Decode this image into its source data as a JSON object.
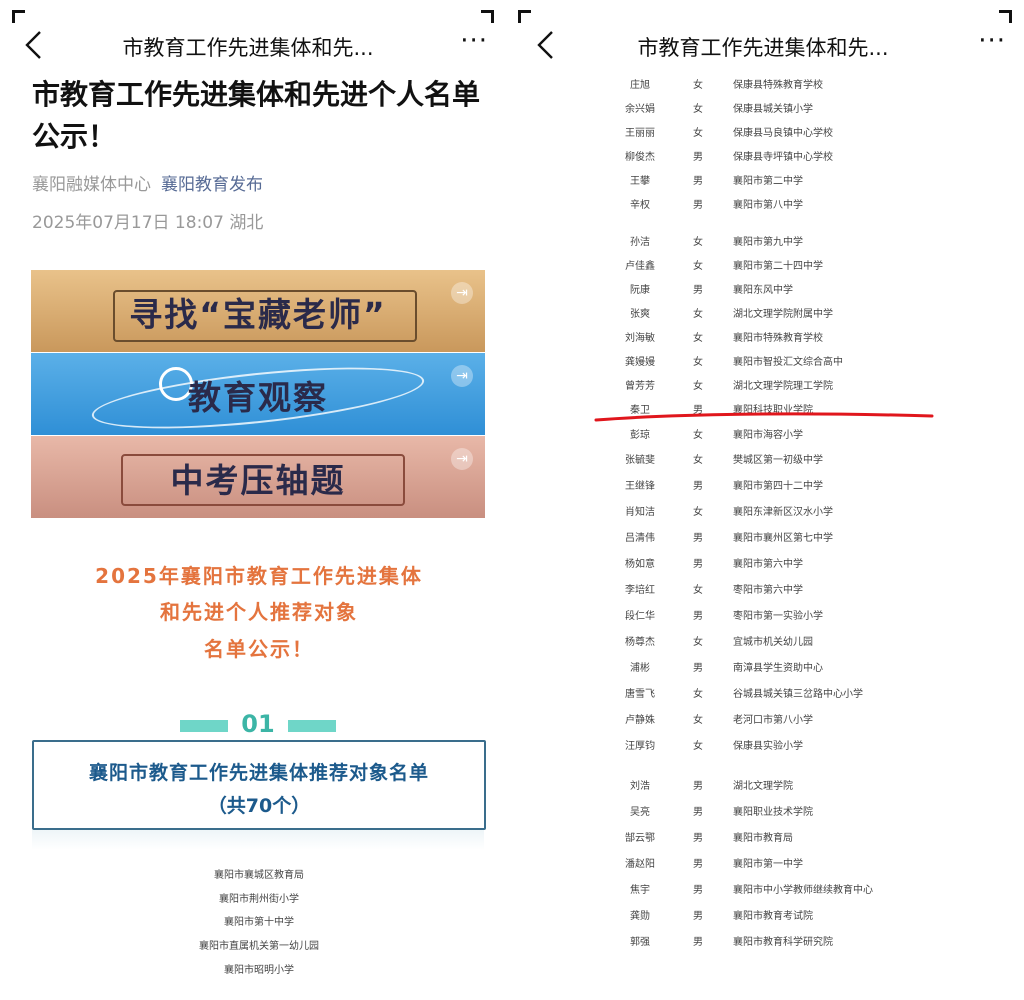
{
  "left": {
    "nav_title": "市教育工作先进集体和先...",
    "more": "···",
    "article_title": "市教育工作先进集体和先进个人名单公示！",
    "source1": "襄阳融媒体中心",
    "source2": "襄阳教育发布",
    "datetime": "2025年07月17日 18:07  湖北",
    "banners": [
      "寻找“宝藏老师”",
      "教育观察",
      "中考压轴题"
    ],
    "headline_lines": [
      "2025年襄阳市教育工作先进集体",
      "和先进个人推荐对象",
      "名单公示！"
    ],
    "section_number": "01",
    "section_title_line1": "襄阳市教育工作先进集体推荐对象名单",
    "section_title_line2": "（共70个）",
    "orgs": [
      "襄阳市襄城区教育局",
      "襄阳市荆州街小学",
      "襄阳市第十中学",
      "襄阳市直属机关第一幼儿园",
      "襄阳市昭明小学"
    ]
  },
  "right": {
    "nav_title": "市教育工作先进集体和先...",
    "more": "···",
    "people": [
      {
        "name": "庄旭",
        "sex": "女",
        "school": "保康县特殊教育学校"
      },
      {
        "name": "余兴娟",
        "sex": "女",
        "school": "保康县城关镇小学"
      },
      {
        "name": "王丽丽",
        "sex": "女",
        "school": "保康县马良镇中心学校"
      },
      {
        "name": "柳俊杰",
        "sex": "男",
        "school": "保康县寺坪镇中心学校"
      },
      {
        "name": "王攀",
        "sex": "男",
        "school": "襄阳市第二中学"
      },
      {
        "name": "辛权",
        "sex": "男",
        "school": "襄阳市第八中学"
      },
      {
        "name": "孙洁",
        "sex": "女",
        "school": "襄阳市第九中学"
      },
      {
        "name": "卢佳鑫",
        "sex": "女",
        "school": "襄阳市第二十四中学"
      },
      {
        "name": "阮康",
        "sex": "男",
        "school": "襄阳东风中学"
      },
      {
        "name": "张爽",
        "sex": "女",
        "school": "湖北文理学院附属中学"
      },
      {
        "name": "刘海敏",
        "sex": "女",
        "school": "襄阳市特殊教育学校"
      },
      {
        "name": "龚嫚嫚",
        "sex": "女",
        "school": "襄阳市智投汇文综合高中"
      },
      {
        "name": "曾芳芳",
        "sex": "女",
        "school": "湖北文理学院理工学院"
      },
      {
        "name": "秦卫",
        "sex": "男",
        "school": "襄阳科技职业学院"
      },
      {
        "name": "彭琼",
        "sex": "女",
        "school": "襄阳市海容小学"
      },
      {
        "name": "张毓斐",
        "sex": "女",
        "school": "樊城区第一初级中学"
      },
      {
        "name": "王继锋",
        "sex": "男",
        "school": "襄阳市第四十二中学"
      },
      {
        "name": "肖知洁",
        "sex": "女",
        "school": "襄阳东津新区汉水小学"
      },
      {
        "name": "吕清伟",
        "sex": "男",
        "school": "襄阳市襄州区第七中学"
      },
      {
        "name": "杨如意",
        "sex": "男",
        "school": "襄阳市第六中学"
      },
      {
        "name": "李培红",
        "sex": "女",
        "school": "枣阳市第六中学"
      },
      {
        "name": "段仁华",
        "sex": "男",
        "school": "枣阳市第一实验小学"
      },
      {
        "name": "杨尊杰",
        "sex": "女",
        "school": "宜城市机关幼儿园"
      },
      {
        "name": "浦彬",
        "sex": "男",
        "school": "南漳县学生资助中心"
      },
      {
        "name": "唐雪飞",
        "sex": "女",
        "school": "谷城县城关镇三岔路中心小学"
      },
      {
        "name": "卢静姝",
        "sex": "女",
        "school": "老河口市第八小学"
      },
      {
        "name": "汪厚钧",
        "sex": "女",
        "school": "保康县实验小学"
      },
      {
        "name": "刘浩",
        "sex": "男",
        "school": "湖北文理学院"
      },
      {
        "name": "吴亮",
        "sex": "男",
        "school": "襄阳职业技术学院"
      },
      {
        "name": "郜云鄂",
        "sex": "男",
        "school": "襄阳市教育局"
      },
      {
        "name": "潘赵阳",
        "sex": "男",
        "school": "襄阳市第一中学"
      },
      {
        "name": "焦宇",
        "sex": "男",
        "school": "襄阳市中小学教师继续教育中心"
      },
      {
        "name": "龚勋",
        "sex": "男",
        "school": "襄阳市教育考试院"
      },
      {
        "name": "郭强",
        "sex": "男",
        "school": "襄阳市教育科学研究院"
      }
    ]
  }
}
